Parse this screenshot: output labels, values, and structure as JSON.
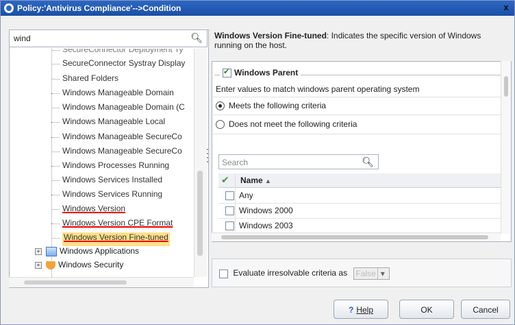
{
  "window": {
    "title": "Policy:'Antivirus Compliance'-->Condition",
    "close_label": "x"
  },
  "left": {
    "search": {
      "value": "wind",
      "icon": "search-icon"
    },
    "tree_items": [
      {
        "label": "SecureConnector Deployment Ty",
        "state": "partial"
      },
      {
        "label": "SecureConnector Systray Display",
        "state": "normal"
      },
      {
        "label": "Shared Folders",
        "state": "normal"
      },
      {
        "label": "Windows Manageable Domain",
        "state": "normal"
      },
      {
        "label": "Windows Manageable Domain (C",
        "state": "normal"
      },
      {
        "label": "Windows Manageable Local",
        "state": "normal"
      },
      {
        "label": "Windows Manageable SecureCo",
        "state": "normal"
      },
      {
        "label": "Windows Manageable SecureCo",
        "state": "normal"
      },
      {
        "label": "Windows Processes Running",
        "state": "normal"
      },
      {
        "label": "Windows Services Installed",
        "state": "normal"
      },
      {
        "label": "Windows Services Running",
        "state": "normal"
      },
      {
        "label": "Windows Version",
        "state": "underlined"
      },
      {
        "label": "Windows Version CPE Format",
        "state": "underlined"
      },
      {
        "label": "Windows Version Fine-tuned",
        "state": "selected"
      }
    ],
    "groups": [
      {
        "label": "Windows Applications",
        "icon": "windows-applications-icon"
      },
      {
        "label": "Windows Security",
        "icon": "shield-icon"
      }
    ]
  },
  "right": {
    "description_title": "Windows Version Fine-tuned",
    "description_text": ": Indicates the specific version of Windows running on the host.",
    "parent": {
      "legend": "Windows Parent",
      "checked": true,
      "hint": "Enter values to match windows parent operating system"
    },
    "criteria": [
      {
        "label": "Meets the following criteria",
        "selected": true
      },
      {
        "label": "Does not meet the following criteria",
        "selected": false
      }
    ],
    "search_placeholder": "Search",
    "table": {
      "column_name": "Name",
      "sort_indicator": "▲",
      "rows": [
        {
          "label": "Any",
          "checked": false
        },
        {
          "label": "Windows 2000",
          "checked": false
        },
        {
          "label": "Windows 2003",
          "checked": false
        }
      ]
    },
    "evaluate": {
      "label": "Evaluate irresolvable criteria as",
      "value": "False"
    }
  },
  "buttons": {
    "help": "Help",
    "ok": "OK",
    "cancel": "Cancel"
  },
  "colors": {
    "title_bar": "#1b4fa5",
    "selected_item": "#ffe08a",
    "underline": "#e00000"
  }
}
